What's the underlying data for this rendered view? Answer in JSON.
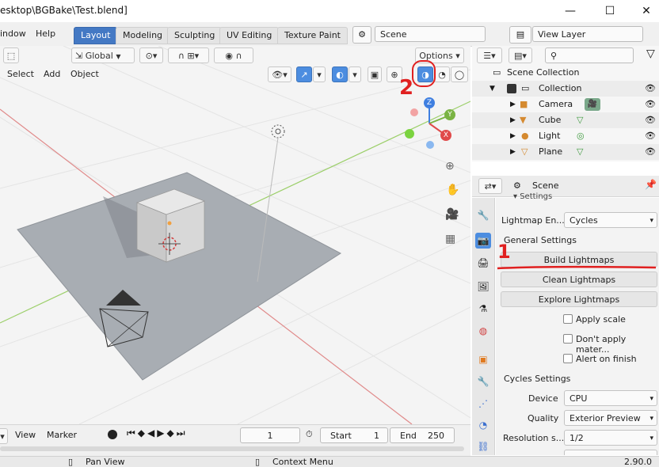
{
  "window": {
    "title": "esktop\\BGBake\\Test.blend]",
    "minimize": "—",
    "maximize": "☐",
    "close": "✕"
  },
  "topbar": {
    "menus": [
      "indow",
      "Help"
    ],
    "workspaces": [
      "Layout",
      "Modeling",
      "Sculpting",
      "UV Editing",
      "Texture Paint"
    ],
    "active_workspace": "Layout",
    "scene": "Scene",
    "view_layer": "View Layer"
  },
  "viewport": {
    "orientation": "Global",
    "options_label": "Options",
    "menus": [
      "Select",
      "Add",
      "Object"
    ],
    "gizmo_axes": [
      "Z",
      "Y",
      "X"
    ]
  },
  "annotations": {
    "one": "1",
    "two": "2"
  },
  "outliner": {
    "search_placeholder": "",
    "scene_collection": "Scene Collection",
    "collection": "Collection",
    "objects": [
      "Camera",
      "Cube",
      "Light",
      "Plane"
    ]
  },
  "properties": {
    "context": "Scene",
    "section_settings": "Settings",
    "lightmap_engine_label": "Lightmap En...",
    "lightmap_engine_value": "Cycles",
    "general_settings": "General Settings",
    "build_lightmaps": "Build Lightmaps",
    "clean_lightmaps": "Clean Lightmaps",
    "explore_lightmaps": "Explore Lightmaps",
    "checkboxes": [
      "Apply scale",
      "Don't apply mater...",
      "Alert on finish"
    ],
    "cycles_settings": "Cycles Settings",
    "device_label": "Device",
    "device_value": "CPU",
    "quality_label": "Quality",
    "quality_value": "Exterior Preview",
    "resolution_label": "Resolution s...",
    "resolution_value": "1/2"
  },
  "timeline": {
    "view": "View",
    "marker": "Marker",
    "current_frame": "1",
    "start_label": "Start",
    "start_value": "1",
    "end_label": "End",
    "end_value": "250"
  },
  "statusbar": {
    "pan_view": "Pan View",
    "context_menu": "Context Menu",
    "version": "2.90.0"
  },
  "colors": {
    "active_tab": "#4479c4",
    "annotation_red": "#e02020",
    "x_axis": "#e04a4a",
    "y_axis": "#7ab344",
    "z_axis": "#3f7fe0"
  }
}
